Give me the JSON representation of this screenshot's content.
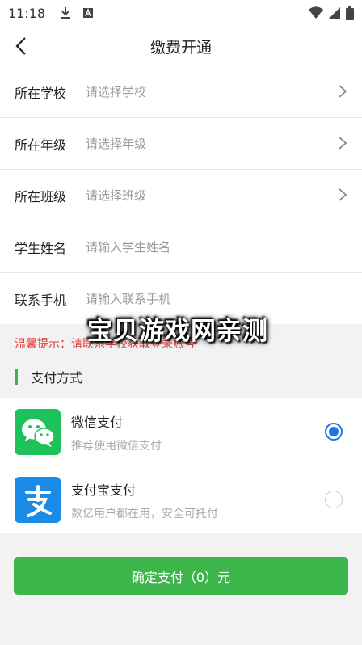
{
  "status_bar": {
    "time": "11:18"
  },
  "header": {
    "title": "缴费开通"
  },
  "form": {
    "rows": [
      {
        "label": "所在学校",
        "placeholder": "请选择学校"
      },
      {
        "label": "所在年级",
        "placeholder": "请选择年级"
      },
      {
        "label": "所在班级",
        "placeholder": "请选择班级"
      },
      {
        "label": "学生姓名",
        "placeholder": "请输入学生姓名"
      },
      {
        "label": "联系手机",
        "placeholder": "请输入联系手机"
      }
    ]
  },
  "hint": {
    "text": "温馨提示：请联系学校获取登录账号"
  },
  "watermark": "宝贝游戏网亲测",
  "payment": {
    "section_title": "支付方式",
    "methods": [
      {
        "name": "微信支付",
        "desc": "推荐使用微信支付",
        "selected": true
      },
      {
        "name": "支付宝支付",
        "desc": "数亿用户都在用，安全可托付",
        "selected": false
      }
    ]
  },
  "confirm_button": "确定支付（0）元",
  "colors": {
    "accent_green": "#3cb64a",
    "radio_blue": "#1677e5",
    "hint_red": "#e53935"
  }
}
